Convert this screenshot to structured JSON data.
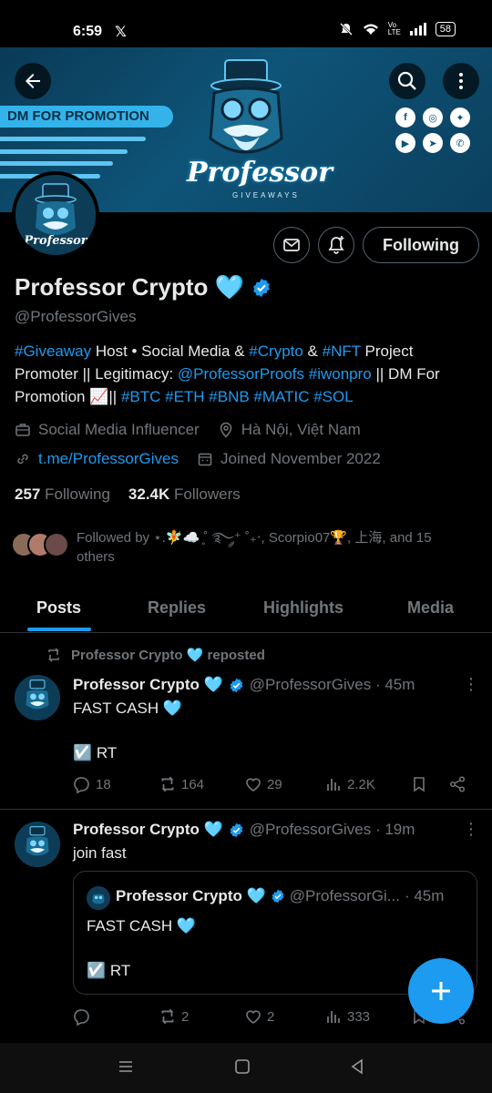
{
  "status": {
    "time": "6:59",
    "x_app": "𝕏",
    "battery": "58",
    "volte": "Vo LTE"
  },
  "banner": {
    "promo": "DM FOR PROMOTION",
    "logo_text": "Professor",
    "logo_sub": "GIVEAWAYS",
    "socials": [
      "facebook-icon",
      "instagram-icon",
      "twitter-icon",
      "youtube-icon",
      "telegram-icon",
      "whatsapp-icon"
    ]
  },
  "profile": {
    "name": "Professor Crypto 🩵",
    "handle": "@ProfessorGives",
    "following_label": "Following",
    "bio": {
      "t1": "#Giveaway",
      "t2": " Host • Social Media & ",
      "t3": "#Crypto",
      "t4": " & ",
      "t5": "#NFT",
      "t6": " Project Promoter || Legitimacy: ",
      "t7": "@ProfessorProofs",
      "t8": " ",
      "t9": "#iwonpro",
      "t10": " || DM For Promotion 📈|| ",
      "t11": "#BTC #ETH #BNB #MATIC #SOL"
    },
    "category": "Social Media Influencer",
    "location": "Hà Nội, Việt Nam",
    "link": "t.me/ProfessorGives",
    "joined": "Joined November 2022",
    "following_count": "257",
    "following_text": "Following",
    "followers_count": "32.4K",
    "followers_text": "Followers",
    "followed_by": "Followed by ⋆.🧚☁️ ̥˚ ࿐༘⁺ ˚₊‧, Scorpio07🏆, 上海, and 15 others"
  },
  "tabs": [
    "Posts",
    "Replies",
    "Highlights",
    "Media"
  ],
  "posts": [
    {
      "repost_label": "Professor Crypto 🩵 reposted",
      "name": "Professor Crypto 🩵",
      "handle": "@ProfessorGives · 45m",
      "line1": "FAST CASH 🩵",
      "line2": "☑️ RT",
      "replies": "18",
      "reposts": "164",
      "likes": "29",
      "views": "2.2K"
    },
    {
      "name": "Professor Crypto 🩵",
      "handle": "@ProfessorGives · 19m",
      "text": "join fast",
      "quote": {
        "name": "Professor Crypto 🩵",
        "handle": "@ProfessorGi...",
        "time": "· 45m",
        "line1": "FAST CASH 🩵",
        "line2": "☑️ RT"
      },
      "replies": "",
      "reposts": "2",
      "likes": "2",
      "views": "333"
    }
  ],
  "colors": {
    "accent": "#1d9bf0",
    "muted": "#71767b",
    "text": "#e7e9ea",
    "banner": "#0e5478"
  }
}
